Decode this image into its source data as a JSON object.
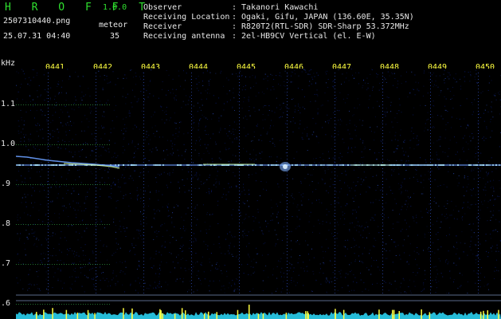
{
  "header": {
    "app_name": "H R O F F T",
    "version": "1.0.0",
    "file_name": "2507310440.png",
    "datetime": "25.07.31 04:40",
    "count_label": "meteor",
    "count_value": "35",
    "info_rows": [
      {
        "label": "Observer",
        "value": ": Takanori Kawachi"
      },
      {
        "label": "Receiving Location",
        "value": ": Ogaki, Gifu, JAPAN (136.60E, 35.35N)"
      },
      {
        "label": "Receiver",
        "value": ": R820T2(RTL-SDR) SDR-Sharp 53.372MHz"
      },
      {
        "label": "Receiving antenna",
        "value": ": 2el-HB9CV Vertical (el. E-W)"
      }
    ]
  },
  "axis": {
    "unit": "kHz",
    "y_ticks": [
      "1.1",
      "1.0",
      ".9",
      ".8",
      ".7",
      ".6"
    ],
    "minute_labels": [
      "0441",
      "0442",
      "0443",
      "0444",
      "0445",
      "0446",
      "0447",
      "0448",
      "0449",
      "0450"
    ]
  },
  "colors": {
    "background": "#000000",
    "noise": "#0a1a6a",
    "signal": "#aee8ff",
    "baseline": "#2ad0f0",
    "marker": "#ffff40",
    "text": "#e8e8e8",
    "accent": "#2fe02f"
  }
}
